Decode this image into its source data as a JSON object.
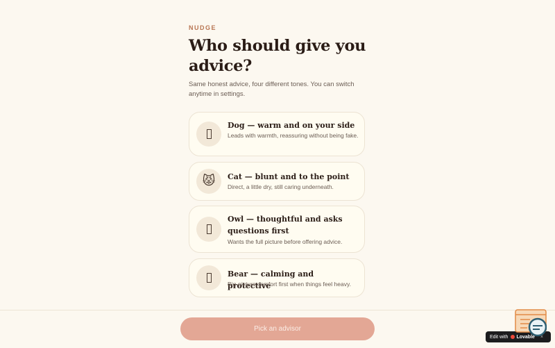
{
  "header": {
    "eyebrow": "NUDGE",
    "title": "Who should give you advice?",
    "subtitle": "Same honest advice, four different tones. You can switch anytime in settings."
  },
  "advisors": [
    {
      "icon": "dog-icon",
      "name": "Dog — warm and on your side",
      "description": "Leads with warmth, reassuring without being fake."
    },
    {
      "icon": "cat-icon",
      "name": "Cat — blunt and to the point",
      "description": "Direct, a little dry, still caring underneath."
    },
    {
      "icon": "owl-icon",
      "name": "Owl — thoughtful and asks questions first",
      "description": "Wants the full picture before offering advice."
    },
    {
      "icon": "bear-icon",
      "name": "Bear — calming and protective",
      "description": "Big-picture comfort first when things feel heavy."
    }
  ],
  "footer": {
    "cta_label": "Pick an advisor"
  },
  "badge": {
    "edit_label": "Edit with",
    "brand": "Lovable",
    "close": "×"
  },
  "colors": {
    "background": "#fcf8f0",
    "accent": "#b87552",
    "cta": "#e3a795",
    "card": "#fffcf1"
  }
}
